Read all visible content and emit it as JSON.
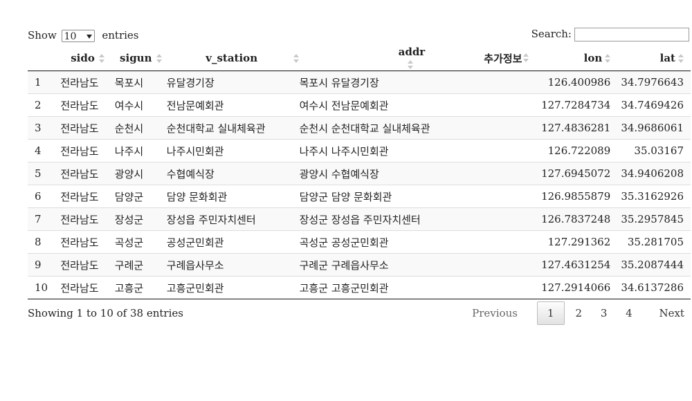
{
  "length": {
    "show": "Show",
    "value": "10",
    "entries": "entries"
  },
  "search": {
    "label": "Search:"
  },
  "columns": [
    "sido",
    "sigun",
    "v_station",
    "addr",
    "추가정보",
    "lon",
    "lat"
  ],
  "rows": [
    {
      "idx": "1",
      "sido": "전라남도",
      "sigun": "목포시",
      "v_station": "유달경기장",
      "addr": "목포시 유달경기장",
      "extra": "",
      "lon": "126.400986",
      "lat": "34.7976643"
    },
    {
      "idx": "2",
      "sido": "전라남도",
      "sigun": "여수시",
      "v_station": "전남문예회관",
      "addr": "여수시 전남문예회관",
      "extra": "",
      "lon": "127.7284734",
      "lat": "34.7469426"
    },
    {
      "idx": "3",
      "sido": "전라남도",
      "sigun": "순천시",
      "v_station": "순천대학교 실내체육관",
      "addr": "순천시 순천대학교 실내체육관",
      "extra": "",
      "lon": "127.4836281",
      "lat": "34.9686061"
    },
    {
      "idx": "4",
      "sido": "전라남도",
      "sigun": "나주시",
      "v_station": "나주시민회관",
      "addr": "나주시 나주시민회관",
      "extra": "",
      "lon": "126.722089",
      "lat": "35.03167"
    },
    {
      "idx": "5",
      "sido": "전라남도",
      "sigun": "광양시",
      "v_station": "수협예식장",
      "addr": "광양시 수협예식장",
      "extra": "",
      "lon": "127.6945072",
      "lat": "34.9406208"
    },
    {
      "idx": "6",
      "sido": "전라남도",
      "sigun": "담양군",
      "v_station": "담양 문화회관",
      "addr": "담양군 담양 문화회관",
      "extra": "",
      "lon": "126.9855879",
      "lat": "35.3162926"
    },
    {
      "idx": "7",
      "sido": "전라남도",
      "sigun": "장성군",
      "v_station": "장성읍 주민자치센터",
      "addr": "장성군 장성읍 주민자치센터",
      "extra": "",
      "lon": "126.7837248",
      "lat": "35.2957845"
    },
    {
      "idx": "8",
      "sido": "전라남도",
      "sigun": "곡성군",
      "v_station": "공성군민회관",
      "addr": "곡성군 공성군민회관",
      "extra": "",
      "lon": "127.291362",
      "lat": "35.281705"
    },
    {
      "idx": "9",
      "sido": "전라남도",
      "sigun": "구례군",
      "v_station": "구례읍사무소",
      "addr": "구례군 구례읍사무소",
      "extra": "",
      "lon": "127.4631254",
      "lat": "35.2087444"
    },
    {
      "idx": "10",
      "sido": "전라남도",
      "sigun": "고흥군",
      "v_station": "고흥군민회관",
      "addr": "고흥군 고흥군민회관",
      "extra": "",
      "lon": "127.2914066",
      "lat": "34.6137286"
    }
  ],
  "info": "Showing 1 to 10 of 38 entries",
  "pager": {
    "previous": "Previous",
    "pages": [
      "1",
      "2",
      "3",
      "4"
    ],
    "next": "Next",
    "current": "1"
  }
}
